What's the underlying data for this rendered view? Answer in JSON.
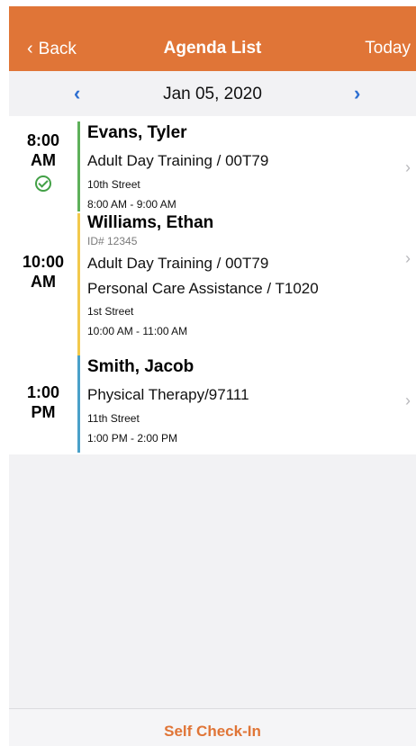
{
  "header": {
    "back_label": "Back",
    "title": "Agenda List",
    "today_label": "Today",
    "color": "#e07537"
  },
  "datebar": {
    "date": "Jan 05, 2020",
    "prev_icon": "chevron-left-icon",
    "next_icon": "chevron-right-icon",
    "arrow_color": "#2d6fd1"
  },
  "appointments": [
    {
      "time_hour": "8:00",
      "time_period": "AM",
      "status_icon": "check-circle-icon",
      "name": "Evans, Tyler",
      "services": [
        "Adult Day Training / 00T79"
      ],
      "street": "10th Street",
      "hours": "8:00 AM - 9:00 AM",
      "bar_color": "#5eb05a"
    },
    {
      "time_hour": "10:00",
      "time_period": "AM",
      "name": "Williams, Ethan",
      "id_label": "ID# 12345",
      "services": [
        "Adult Day Training / 00T79",
        "Personal Care Assistance / T1020"
      ],
      "street": "1st Street",
      "hours": "10:00 AM - 11:00 AM",
      "bar_color": "#f2c94c"
    },
    {
      "time_hour": "1:00",
      "time_period": "PM",
      "name": "Smith, Jacob",
      "services": [
        "Physical Therapy/97111"
      ],
      "street": "11th Street",
      "hours": "1:00 PM - 2:00 PM",
      "bar_color": "#4aa0c9"
    }
  ],
  "footer": {
    "label": "Self Check-In"
  }
}
